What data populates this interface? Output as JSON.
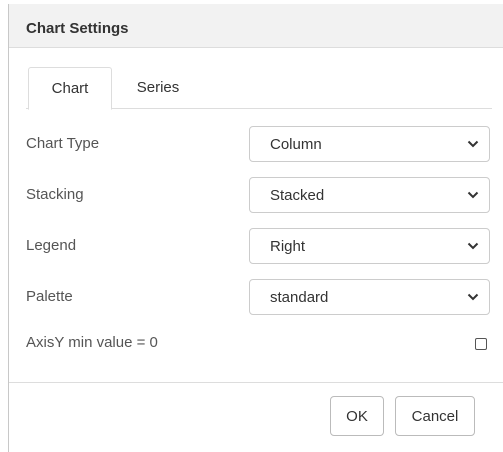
{
  "dialog": {
    "title": "Chart Settings"
  },
  "tabs": [
    {
      "label": "Chart",
      "active": true
    },
    {
      "label": "Series",
      "active": false
    }
  ],
  "fields": {
    "chart_type": {
      "label": "Chart Type",
      "value": "Column"
    },
    "stacking": {
      "label": "Stacking",
      "value": "Stacked"
    },
    "legend": {
      "label": "Legend",
      "value": "Right"
    },
    "palette": {
      "label": "Palette",
      "value": "standard"
    },
    "axis_y_min": {
      "label": "AxisY min value = 0",
      "checked": false
    }
  },
  "buttons": {
    "ok": "OK",
    "cancel": "Cancel"
  },
  "icons": {
    "select_chevron": "chevron-down-icon"
  },
  "colors": {
    "titlebar_bg": "#f2f2f2",
    "border": "#cccccc",
    "text": "#333333"
  }
}
